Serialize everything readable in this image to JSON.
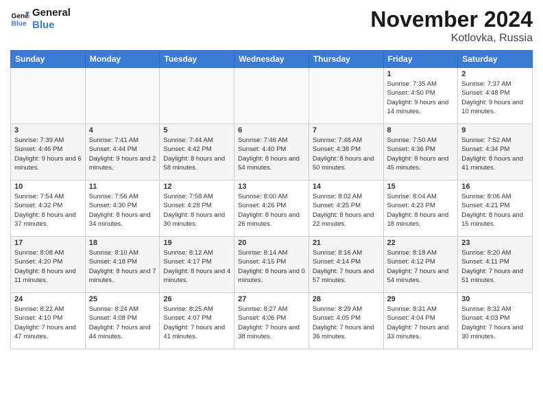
{
  "header": {
    "logo_line1": "General",
    "logo_line2": "Blue",
    "month": "November 2024",
    "location": "Kotlovka, Russia"
  },
  "weekdays": [
    "Sunday",
    "Monday",
    "Tuesday",
    "Wednesday",
    "Thursday",
    "Friday",
    "Saturday"
  ],
  "weeks": [
    [
      {
        "day": "",
        "info": ""
      },
      {
        "day": "",
        "info": ""
      },
      {
        "day": "",
        "info": ""
      },
      {
        "day": "",
        "info": ""
      },
      {
        "day": "",
        "info": ""
      },
      {
        "day": "1",
        "info": "Sunrise: 7:35 AM\nSunset: 4:50 PM\nDaylight: 9 hours and 14 minutes."
      },
      {
        "day": "2",
        "info": "Sunrise: 7:37 AM\nSunset: 4:48 PM\nDaylight: 9 hours and 10 minutes."
      }
    ],
    [
      {
        "day": "3",
        "info": "Sunrise: 7:39 AM\nSunset: 4:46 PM\nDaylight: 9 hours and 6 minutes."
      },
      {
        "day": "4",
        "info": "Sunrise: 7:41 AM\nSunset: 4:44 PM\nDaylight: 9 hours and 2 minutes."
      },
      {
        "day": "5",
        "info": "Sunrise: 7:44 AM\nSunset: 4:42 PM\nDaylight: 8 hours and 58 minutes."
      },
      {
        "day": "6",
        "info": "Sunrise: 7:46 AM\nSunset: 4:40 PM\nDaylight: 8 hours and 54 minutes."
      },
      {
        "day": "7",
        "info": "Sunrise: 7:48 AM\nSunset: 4:38 PM\nDaylight: 8 hours and 50 minutes."
      },
      {
        "day": "8",
        "info": "Sunrise: 7:50 AM\nSunset: 4:36 PM\nDaylight: 8 hours and 45 minutes."
      },
      {
        "day": "9",
        "info": "Sunrise: 7:52 AM\nSunset: 4:34 PM\nDaylight: 8 hours and 41 minutes."
      }
    ],
    [
      {
        "day": "10",
        "info": "Sunrise: 7:54 AM\nSunset: 4:32 PM\nDaylight: 8 hours and 37 minutes."
      },
      {
        "day": "11",
        "info": "Sunrise: 7:56 AM\nSunset: 4:30 PM\nDaylight: 8 hours and 34 minutes."
      },
      {
        "day": "12",
        "info": "Sunrise: 7:58 AM\nSunset: 4:28 PM\nDaylight: 8 hours and 30 minutes."
      },
      {
        "day": "13",
        "info": "Sunrise: 8:00 AM\nSunset: 4:26 PM\nDaylight: 8 hours and 26 minutes."
      },
      {
        "day": "14",
        "info": "Sunrise: 8:02 AM\nSunset: 4:25 PM\nDaylight: 8 hours and 22 minutes."
      },
      {
        "day": "15",
        "info": "Sunrise: 8:04 AM\nSunset: 4:23 PM\nDaylight: 8 hours and 18 minutes."
      },
      {
        "day": "16",
        "info": "Sunrise: 8:06 AM\nSunset: 4:21 PM\nDaylight: 8 hours and 15 minutes."
      }
    ],
    [
      {
        "day": "17",
        "info": "Sunrise: 8:08 AM\nSunset: 4:20 PM\nDaylight: 8 hours and 11 minutes."
      },
      {
        "day": "18",
        "info": "Sunrise: 8:10 AM\nSunset: 4:18 PM\nDaylight: 8 hours and 7 minutes."
      },
      {
        "day": "19",
        "info": "Sunrise: 8:12 AM\nSunset: 4:17 PM\nDaylight: 8 hours and 4 minutes."
      },
      {
        "day": "20",
        "info": "Sunrise: 8:14 AM\nSunset: 4:15 PM\nDaylight: 8 hours and 0 minutes."
      },
      {
        "day": "21",
        "info": "Sunrise: 8:16 AM\nSunset: 4:14 PM\nDaylight: 7 hours and 57 minutes."
      },
      {
        "day": "22",
        "info": "Sunrise: 8:18 AM\nSunset: 4:12 PM\nDaylight: 7 hours and 54 minutes."
      },
      {
        "day": "23",
        "info": "Sunrise: 8:20 AM\nSunset: 4:11 PM\nDaylight: 7 hours and 51 minutes."
      }
    ],
    [
      {
        "day": "24",
        "info": "Sunrise: 8:22 AM\nSunset: 4:10 PM\nDaylight: 7 hours and 47 minutes."
      },
      {
        "day": "25",
        "info": "Sunrise: 8:24 AM\nSunset: 4:08 PM\nDaylight: 7 hours and 44 minutes."
      },
      {
        "day": "26",
        "info": "Sunrise: 8:25 AM\nSunset: 4:07 PM\nDaylight: 7 hours and 41 minutes."
      },
      {
        "day": "27",
        "info": "Sunrise: 8:27 AM\nSunset: 4:06 PM\nDaylight: 7 hours and 38 minutes."
      },
      {
        "day": "28",
        "info": "Sunrise: 8:29 AM\nSunset: 4:05 PM\nDaylight: 7 hours and 36 minutes."
      },
      {
        "day": "29",
        "info": "Sunrise: 8:31 AM\nSunset: 4:04 PM\nDaylight: 7 hours and 33 minutes."
      },
      {
        "day": "30",
        "info": "Sunrise: 8:32 AM\nSunset: 4:03 PM\nDaylight: 7 hours and 30 minutes."
      }
    ]
  ]
}
